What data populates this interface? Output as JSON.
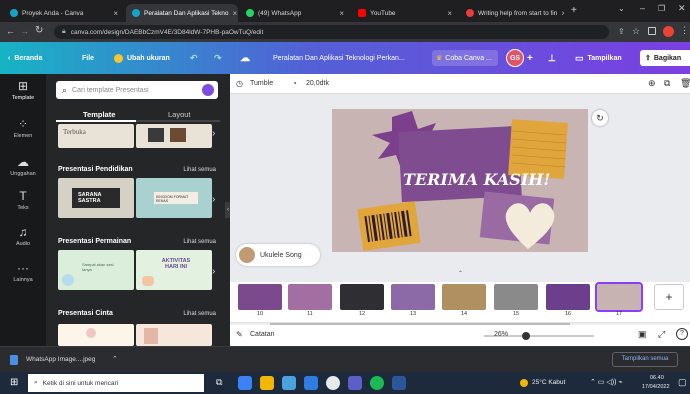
{
  "tabs": [
    {
      "label": "Proyek Anda - Canva",
      "color": "#14a3c7"
    },
    {
      "label": "Peralatan Dan Aplikasi Tekno",
      "color": "#14a3c7"
    },
    {
      "label": "(49) WhatsApp",
      "color": "#25d366"
    },
    {
      "label": "YouTube",
      "color": "#ff0000"
    },
    {
      "label": "Writing help from start to fin",
      "color": "#e43d3d"
    }
  ],
  "browser": {
    "url": "canva.com/design/DAEBbCzmV4E/3D84ldW-7PHB-paOwTuQ/edit",
    "new_tab": "+"
  },
  "header": {
    "home": "Beranda",
    "file": "File",
    "resize": "Ubah ukuran",
    "doc_title": "Peralatan Dan Aplikasi Teknologi Perkan...",
    "trial": "Coba Canva ...",
    "avatar": "GS",
    "present": "Tampilkan",
    "share": "Bagikan"
  },
  "rail": [
    {
      "label": "Template",
      "icon": "template-icon"
    },
    {
      "label": "Elemen",
      "icon": "elements-icon"
    },
    {
      "label": "Unggahan",
      "icon": "upload-icon"
    },
    {
      "label": "Teks",
      "icon": "text-icon"
    },
    {
      "label": "Audio",
      "icon": "audio-icon"
    },
    {
      "label": "Lainnya",
      "icon": "more-icon"
    }
  ],
  "panel": {
    "search_placeholder": "Cari template Presentasi",
    "tab_template": "Template",
    "tab_layout": "Layout",
    "top_thumb_text": "Terbuka",
    "sections": [
      {
        "title": "Presentasi Pendidikan",
        "see_all": "Lihat semua",
        "thumb_a": "SARANA SASTRA",
        "thumb_b": "KINGDOM FORMAT RENAS"
      },
      {
        "title": "Presentasi Permainan",
        "see_all": "Lihat semua",
        "thumb_a": "Sampai akan sesi tanya",
        "thumb_b": "AKTIVITAS HARI INI"
      },
      {
        "title": "Presentasi Cinta",
        "see_all": "Lihat semua"
      }
    ]
  },
  "toolbar": {
    "animation": "Tumble",
    "duration": "20,0dtk"
  },
  "slide": {
    "title": "TERIMA KASIH!"
  },
  "audio": {
    "label": "Ukulele Song"
  },
  "pages": [
    {
      "num": "10",
      "color": "#7a4a8c"
    },
    {
      "num": "11",
      "color": "#a36fa3"
    },
    {
      "num": "12",
      "color": "#2e2e33"
    },
    {
      "num": "13",
      "color": "#8c6aa8"
    },
    {
      "num": "14",
      "color": "#b09060"
    },
    {
      "num": "15",
      "color": "#8a8a8a"
    },
    {
      "num": "16",
      "color": "#6b3f8c"
    },
    {
      "num": "17",
      "color": "#c7b3b1"
    }
  ],
  "bottom": {
    "notes": "Catatan",
    "zoom": "26%"
  },
  "download": {
    "file": "WhatsApp Image....jpeg",
    "show_all": "Tampilkan semua"
  },
  "taskbar": {
    "search": "Ketik di sini untuk mencari",
    "weather": "25°C  Kabut",
    "time": "06.40",
    "date": "17/04/2022"
  }
}
